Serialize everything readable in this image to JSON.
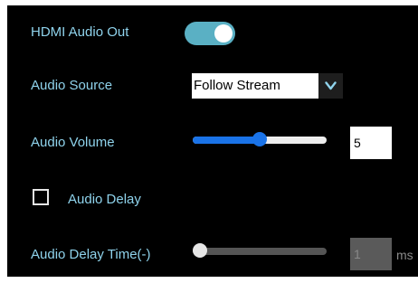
{
  "hdmi_audio_out": {
    "label": "HDMI Audio Out",
    "enabled": true
  },
  "audio_source": {
    "label": "Audio Source",
    "selected": "Follow Stream"
  },
  "audio_volume": {
    "label": "Audio Volume",
    "value": "5",
    "slider_fraction": 0.5
  },
  "audio_delay": {
    "label": "Audio Delay",
    "checked": false
  },
  "audio_delay_time": {
    "label": "Audio Delay Time(-)",
    "value": "1",
    "unit": "ms",
    "slider_fraction": 0,
    "disabled": true
  },
  "colors": {
    "panel_background": "#000000",
    "label_text": "#8fd3ec",
    "toggle_on": "#5ab0c4",
    "slider_accent": "#1a73e8",
    "disabled_input": "#5a5a5a"
  },
  "icons": {
    "select_arrow": "chevron-down-icon"
  }
}
